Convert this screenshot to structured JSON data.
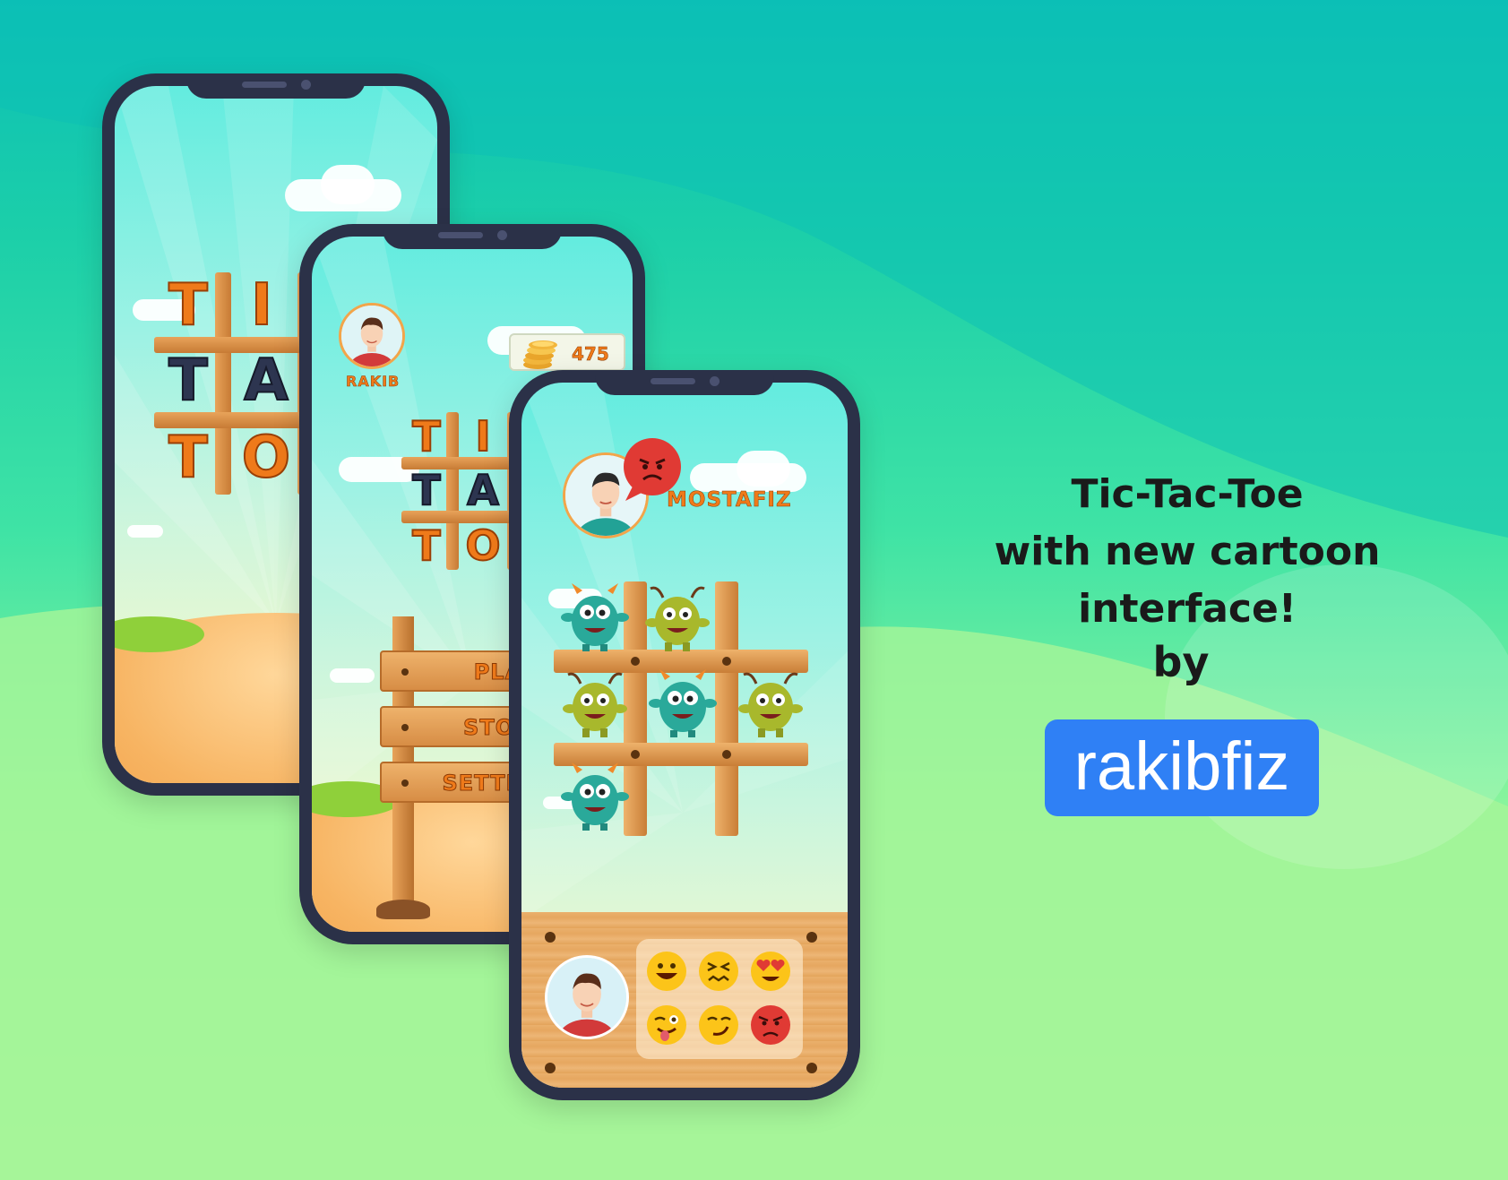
{
  "colors": {
    "brand_badge": "#2f80f5",
    "orange_text": "#ef7a1a",
    "phone_frame": "#2b3148",
    "angry_red": "#e03a34"
  },
  "headline": {
    "line1": "Tic-Tac-Toe",
    "line2": "with new cartoon interface!",
    "by": "by",
    "brand": "rakibfiz"
  },
  "menu_screen": {
    "player_name": "RAKIB",
    "coins": "475",
    "menu_items": [
      "PLAY",
      "STORE",
      "SETTINGS"
    ]
  },
  "game_screen": {
    "opponent_name": "MOSTAFIZ",
    "board": [
      "teal-monster",
      "olive-monster",
      "",
      "olive-monster",
      "teal-monster",
      "olive-monster",
      "teal-monster",
      "",
      ""
    ],
    "emojis": [
      "grin-emoji",
      "confounded-emoji",
      "heart-eyes-emoji",
      "wink-tongue-emoji",
      "smirk-emoji",
      "angry-emoji"
    ]
  }
}
